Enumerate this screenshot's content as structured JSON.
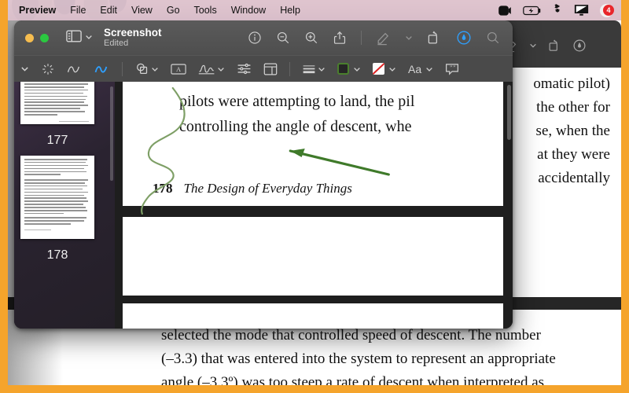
{
  "menubar": {
    "app": "Preview",
    "items": [
      "File",
      "Edit",
      "View",
      "Go",
      "Tools",
      "Window",
      "Help"
    ],
    "status_icons": [
      "screen-recording-icon",
      "battery-charging-icon",
      "dropbox-icon",
      "display-icon",
      "notification-badge"
    ],
    "badge_count": "4",
    "bg_color": "#ecc8e2"
  },
  "window": {
    "title": "Screenshot",
    "subtitle": "Edited",
    "traffic_lights": [
      "minimize-yellow",
      "zoom-green"
    ],
    "sidebar_toggle": "sidebar-toggle-icon",
    "toolbar_icons": [
      "info-icon",
      "zoom-out-icon",
      "zoom-in-icon",
      "share-icon",
      "markup-pen-icon",
      "chevron-down-icon",
      "rotate-icon",
      "annotate-icon",
      "search-icon"
    ]
  },
  "markup_toolbar": {
    "items": [
      "chevron-down-icon",
      "instant-alpha-icon",
      "sketch-icon",
      "draw-icon",
      "shapes-icon",
      "chevron-down-icon",
      "text-box-icon",
      "signature-icon",
      "chevron-down-icon",
      "adjust-color-icon",
      "adjust-size-icon",
      "shape-style-icon",
      "chevron-down-icon",
      "border-color-icon",
      "chevron-down-icon",
      "fill-color-icon",
      "chevron-down-icon",
      "text-style-icon",
      "chevron-down-icon",
      "note-icon"
    ],
    "text_style_label": "Aa",
    "active_tool": "draw-icon",
    "border_color": "#4a7f2d",
    "fill_color": "none",
    "accent_color": "#2ea0ff"
  },
  "sidebar": {
    "thumbnails": [
      {
        "page": "177"
      },
      {
        "page": "178"
      }
    ]
  },
  "document": {
    "line1": "pilots were attempting to land, the pil",
    "line2": "controlling the angle of descent, whe",
    "footer_page": "178",
    "footer_title": "The Design of Everyday Things",
    "annotations": [
      {
        "name": "squiggle-annotation",
        "color": "#7b9b63"
      },
      {
        "name": "arrow-annotation",
        "color": "#3f7a2a"
      }
    ]
  },
  "background_document": {
    "top_lines": [
      "omatic pilot)",
      "the other for",
      "se, when the",
      "at they were",
      "accidentally"
    ],
    "bottom_lines": [
      "selected the mode that controlled speed of descent. The number",
      "(–3.3) that was entered into the system to represent an appropriate",
      "angle (–3.3º) was too steep a rate of descent when interpreted as"
    ]
  },
  "overlap_text": {
    "left_fragment_1": "e pil",
    "left_fragment_2": "whe"
  },
  "frame": {
    "color": "#f5a42c"
  }
}
